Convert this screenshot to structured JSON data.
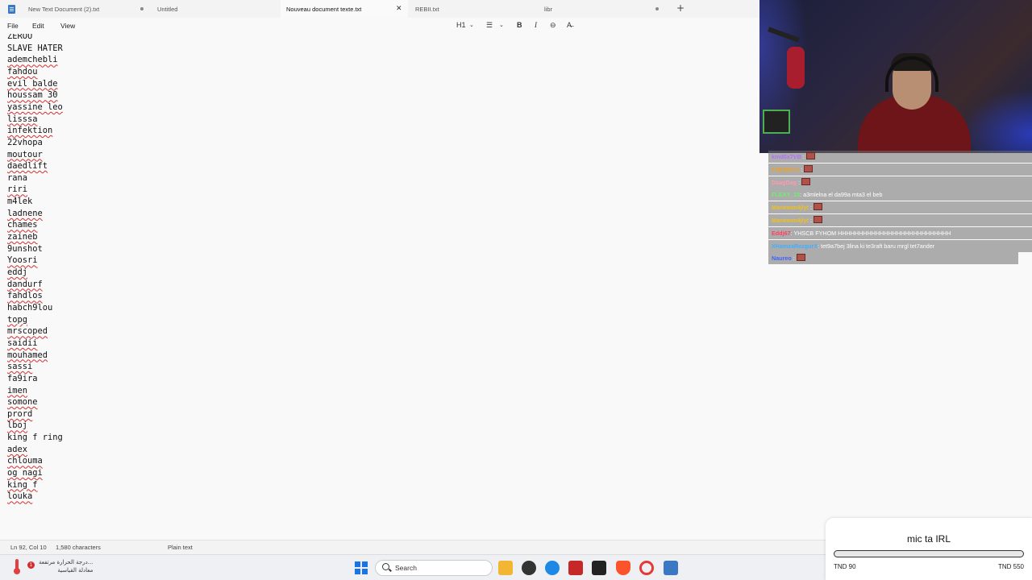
{
  "tabs": [
    {
      "label": "New Text Document (2).txt",
      "unsaved": true
    },
    {
      "label": "Untitled",
      "unsaved": false
    },
    {
      "label": "Nouveau document texte.txt",
      "active": true
    },
    {
      "label": "REBII.txt",
      "unsaved": false
    },
    {
      "label": "libr",
      "unsaved": true
    }
  ],
  "menu": {
    "file": "File",
    "edit": "Edit",
    "view": "View"
  },
  "toolbar": {
    "heading": "H1",
    "list": "☰",
    "bold": "B",
    "italic": "I",
    "link": "⊖",
    "clear": "A̶"
  },
  "editor": {
    "lines": [
      {
        "text": "ZEROU",
        "squiggle": false
      },
      {
        "text": "SLAVE HATER",
        "squiggle": false
      },
      {
        "text": "ademchebli",
        "squiggle": true
      },
      {
        "text": "fahdou",
        "squiggle": true
      },
      {
        "text": "evil balde",
        "squiggle": true
      },
      {
        "text": "houssam 30",
        "squiggle": true
      },
      {
        "text": "yassine leo",
        "squiggle": true
      },
      {
        "text": "lisssa",
        "squiggle": true
      },
      {
        "text": "infektion",
        "squiggle": true
      },
      {
        "text": "22vhopa",
        "squiggle": false
      },
      {
        "text": "moutour",
        "squiggle": true
      },
      {
        "text": "daedlift",
        "squiggle": true
      },
      {
        "text": "rana",
        "squiggle": false
      },
      {
        "text": "riri",
        "squiggle": true
      },
      {
        "text": "m4lek",
        "squiggle": false
      },
      {
        "text": "ladnene",
        "squiggle": true
      },
      {
        "text": "chames",
        "squiggle": true
      },
      {
        "text": "zaineb",
        "squiggle": true
      },
      {
        "text": "9unshot",
        "squiggle": false
      },
      {
        "text": "Yoosri",
        "squiggle": true
      },
      {
        "text": "eddj",
        "squiggle": true
      },
      {
        "text": "dandurf",
        "squiggle": true
      },
      {
        "text": "fahdlos",
        "squiggle": true
      },
      {
        "text": "habch9lou",
        "squiggle": false
      },
      {
        "text": "topg",
        "squiggle": true
      },
      {
        "text": "mrscoped",
        "squiggle": true
      },
      {
        "text": "saidii",
        "squiggle": true
      },
      {
        "text": "mouhamed",
        "squiggle": true
      },
      {
        "text": "sassi",
        "squiggle": true
      },
      {
        "text": "fa9ira",
        "squiggle": false
      },
      {
        "text": "imen",
        "squiggle": true
      },
      {
        "text": "somone",
        "squiggle": true
      },
      {
        "text": "prord",
        "squiggle": true
      },
      {
        "text": "lboj",
        "squiggle": true
      },
      {
        "text": "king f ring",
        "squiggle": false
      },
      {
        "text": "adex",
        "squiggle": true
      },
      {
        "text": "chlouma",
        "squiggle": true
      },
      {
        "text": "og nagi",
        "squiggle": true
      },
      {
        "text": "king f",
        "squiggle": true
      },
      {
        "text": "louka",
        "squiggle": true
      }
    ]
  },
  "status": {
    "position": "Ln 92, Col 10",
    "chars": "1,580 characters",
    "format": "Plain text"
  },
  "taskbar": {
    "weather_line1": "درجة الحرارة مرتفعة...",
    "weather_line2": "معادلة القياسية",
    "weather_badge": "1",
    "search_label": "Search"
  },
  "chat": [
    {
      "user": "kmd0x7VB",
      "msg": "",
      "color": "#b070ff",
      "emote": true
    },
    {
      "user": "TSE9DVm",
      "msg": "",
      "color": "#f0a020",
      "emote": true
    },
    {
      "user": "DaagDag",
      "msg": "",
      "color": "#ff9ab0",
      "emote": true
    },
    {
      "user": "FLEXY_15",
      "msg": ": a3mlelna el da99a mta3 el beb",
      "color": "#6cf06c",
      "emote": false
    },
    {
      "user": "Mariemm4jlyt",
      "msg": "",
      "color": "#f0c020",
      "emote": true
    },
    {
      "user": "Mariemm4jlyt",
      "msg": "",
      "color": "#f0c020",
      "emote": true
    },
    {
      "user": "Eddj67",
      "msg": ": YHSCB FYHOM HHHHHHHHHHHHHHHHHHHHHHHHHHH",
      "color": "#ff4060",
      "emote": false
    },
    {
      "user": "XHamzaRezgurX",
      "msg": ": tet9a7bej 3lina ki te3raft baru mrgl tet7ander",
      "color": "#3fb0ff",
      "emote": false
    },
    {
      "user": "Naureo",
      "msg": "",
      "color": "#4060ff",
      "emote": true
    }
  ],
  "goal": {
    "title": "mic ta IRL",
    "min_label": "TND 90",
    "max_label": "TND 550",
    "progress_fraction": 0.0
  }
}
